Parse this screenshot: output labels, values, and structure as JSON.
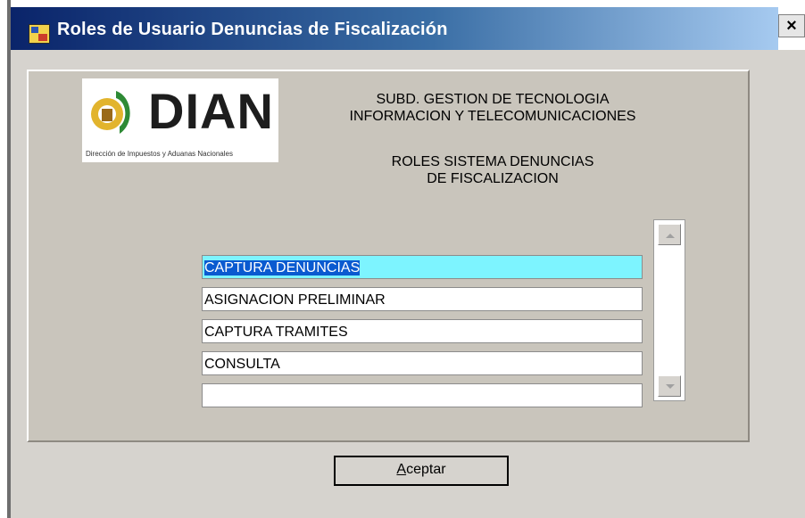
{
  "window": {
    "title": "Roles de Usuario  Denuncias  de Fiscalización",
    "close_label": "×"
  },
  "logo": {
    "word": "DIAN",
    "subtitle": "Dirección de Impuestos y Aduanas Nacionales"
  },
  "header": {
    "line1": "SUBD. GESTION DE TECNOLOGIA",
    "line2": "INFORMACION Y TELECOMUNICACIONES",
    "line3": "ROLES SISTEMA DENUNCIAS",
    "line4": "DE FISCALIZACION"
  },
  "roles": {
    "items": [
      "CAPTURA DENUNCIAS",
      "ASIGNACION PRELIMINAR",
      "CAPTURA TRAMITES",
      "CONSULTA",
      ""
    ],
    "selected_index": 0
  },
  "buttons": {
    "accept_prefix": "A",
    "accept_rest": "ceptar"
  },
  "icons": {
    "title_icon": "app-icon",
    "scroll_up": "chevron-up-icon",
    "scroll_down": "chevron-down-icon"
  },
  "colors": {
    "title_gradient_start": "#0a246a",
    "selected_row": "#7df4ff",
    "selected_text_highlight": "#0a5ad0",
    "logo_green": "#2e8a35"
  }
}
